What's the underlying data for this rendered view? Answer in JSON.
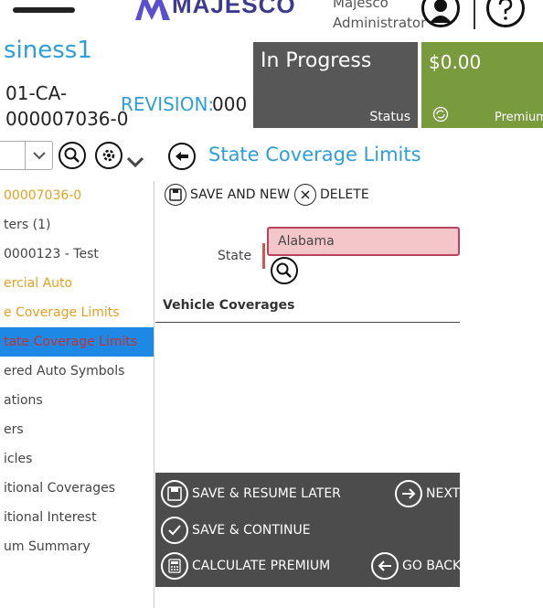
{
  "header": {
    "logo_text": "MAJESCO",
    "user_line1": "Majesco",
    "user_line2": "Administrator",
    "icons": [
      "hamburger-menu-icon",
      "user-icon",
      "help-icon"
    ]
  },
  "business": {
    "name": "siness1",
    "policy_line1": "01-CA-",
    "policy_line2": "000007036-0",
    "revision_label": "REVISION:",
    "revision_value": "000"
  },
  "status_tile": {
    "value": "In Progress",
    "label": "Status",
    "color": "#575757"
  },
  "premium_tile": {
    "value": "$0.00",
    "label": "Premium",
    "color": "#7a9a3e"
  },
  "page_title": "State Coverage Limits",
  "toolbar": {
    "save_new": "SAVE AND NEW",
    "delete": "DELETE"
  },
  "sidebar": {
    "items": [
      {
        "label": "00007036-0",
        "style": "orange"
      },
      {
        "label": "ters (1)",
        "style": "normal"
      },
      {
        "label": "0000123 - Test",
        "style": "normal"
      },
      {
        "label": "ercial Auto",
        "style": "orange"
      },
      {
        "label": "e Coverage Limits",
        "style": "orange"
      },
      {
        "label": "tate Coverage Limits",
        "style": "active"
      },
      {
        "label": "ered Auto Symbols",
        "style": "normal"
      },
      {
        "label": "ations",
        "style": "normal"
      },
      {
        "label": "ers",
        "style": "normal"
      },
      {
        "label": "icles",
        "style": "normal"
      },
      {
        "label": "itional Coverages",
        "style": "normal"
      },
      {
        "label": "itional Interest",
        "style": "normal"
      },
      {
        "label": "um Summary",
        "style": "normal"
      }
    ]
  },
  "form": {
    "state_label": "State",
    "state_value": "Alabama",
    "section_title": "Vehicle Coverages"
  },
  "bottom": {
    "save_resume": "SAVE & RESUME LATER",
    "next": "NEXT",
    "save_continue": "SAVE & CONTINUE",
    "calculate": "CALCULATE PREMIUM",
    "go_back": "GO BACK"
  },
  "colors": {
    "accent_blue": "#2e9fd6",
    "active_bg": "#1e88e5",
    "orange": "#e6a020",
    "error_bg": "#f4c6c9",
    "panel_dark": "#4c4c4c"
  }
}
